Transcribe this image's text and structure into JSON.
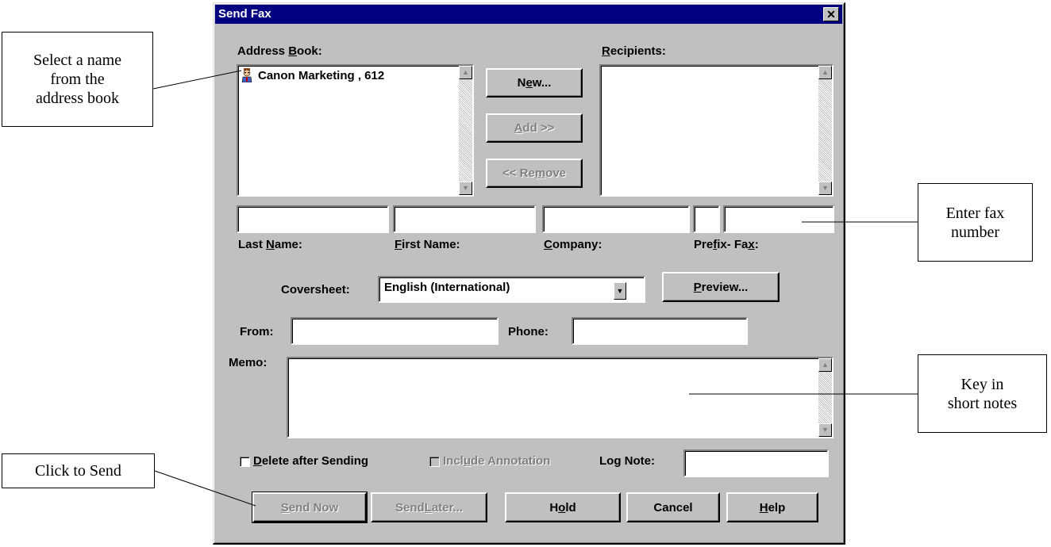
{
  "dialog": {
    "title": "Send Fax",
    "close_glyph": "✕",
    "address_book_label_pre": "Address ",
    "address_book_label_u": "B",
    "address_book_label_post": "ook:",
    "address_book_items": [
      "Canon Marketing , 612"
    ],
    "recipients_label_u": "R",
    "recipients_label_post": "ecipients:",
    "new_pre": "N",
    "new_u": "e",
    "new_post": "w...",
    "add_u": "A",
    "add_post": "dd >>",
    "remove_pre": "<< Re",
    "remove_u": "m",
    "remove_post": "ove",
    "last_name_pre": "Last ",
    "last_name_u": "N",
    "last_name_post": "ame:",
    "first_name_u": "F",
    "first_name_post": "irst Name:",
    "company_u": "C",
    "company_post": "ompany:",
    "prefix_fax_pre": "Pre",
    "prefix_fax_u": "f",
    "prefix_fax_mid": "ix- Fa",
    "prefix_fax_u2": "x",
    "prefix_fax_post": ":",
    "coversheet_label": "Coversheet:",
    "coversheet_value": "English (International)",
    "preview_u": "P",
    "preview_post": "review...",
    "from_label": "From:",
    "phone_label": "Phone:",
    "memo_label": "Memo:",
    "delete_pre": "",
    "delete_u": "D",
    "delete_post": "elete after Sending",
    "include_pre": "Incl",
    "include_u": "u",
    "include_post": "de Annotation",
    "lognote_pre": "Lo",
    "lognote_u": "g",
    "lognote_post": " Note:",
    "send_now_u": "S",
    "send_now_post": "end Now",
    "send_later_pre": "Send ",
    "send_later_u": "L",
    "send_later_post": "ater...",
    "hold_pre": "H",
    "hold_u": "o",
    "hold_post": "ld",
    "cancel": "Cancel",
    "help_u": "H",
    "help_post": "elp",
    "fields": {
      "last_name": "",
      "first_name": "",
      "company": "",
      "prefix": "",
      "fax": "",
      "from": "",
      "phone": "",
      "memo": "",
      "log_note": ""
    }
  },
  "callouts": {
    "select_name": "Select a name\nfrom the\naddress book",
    "enter_fax": "Enter fax\nnumber",
    "key_in": "Key in\nshort notes",
    "click_send": "Click to Send"
  },
  "colors": {
    "title_bar": "#000080",
    "dialog_bg": "#c0c0c0",
    "disabled_text": "#808080"
  }
}
